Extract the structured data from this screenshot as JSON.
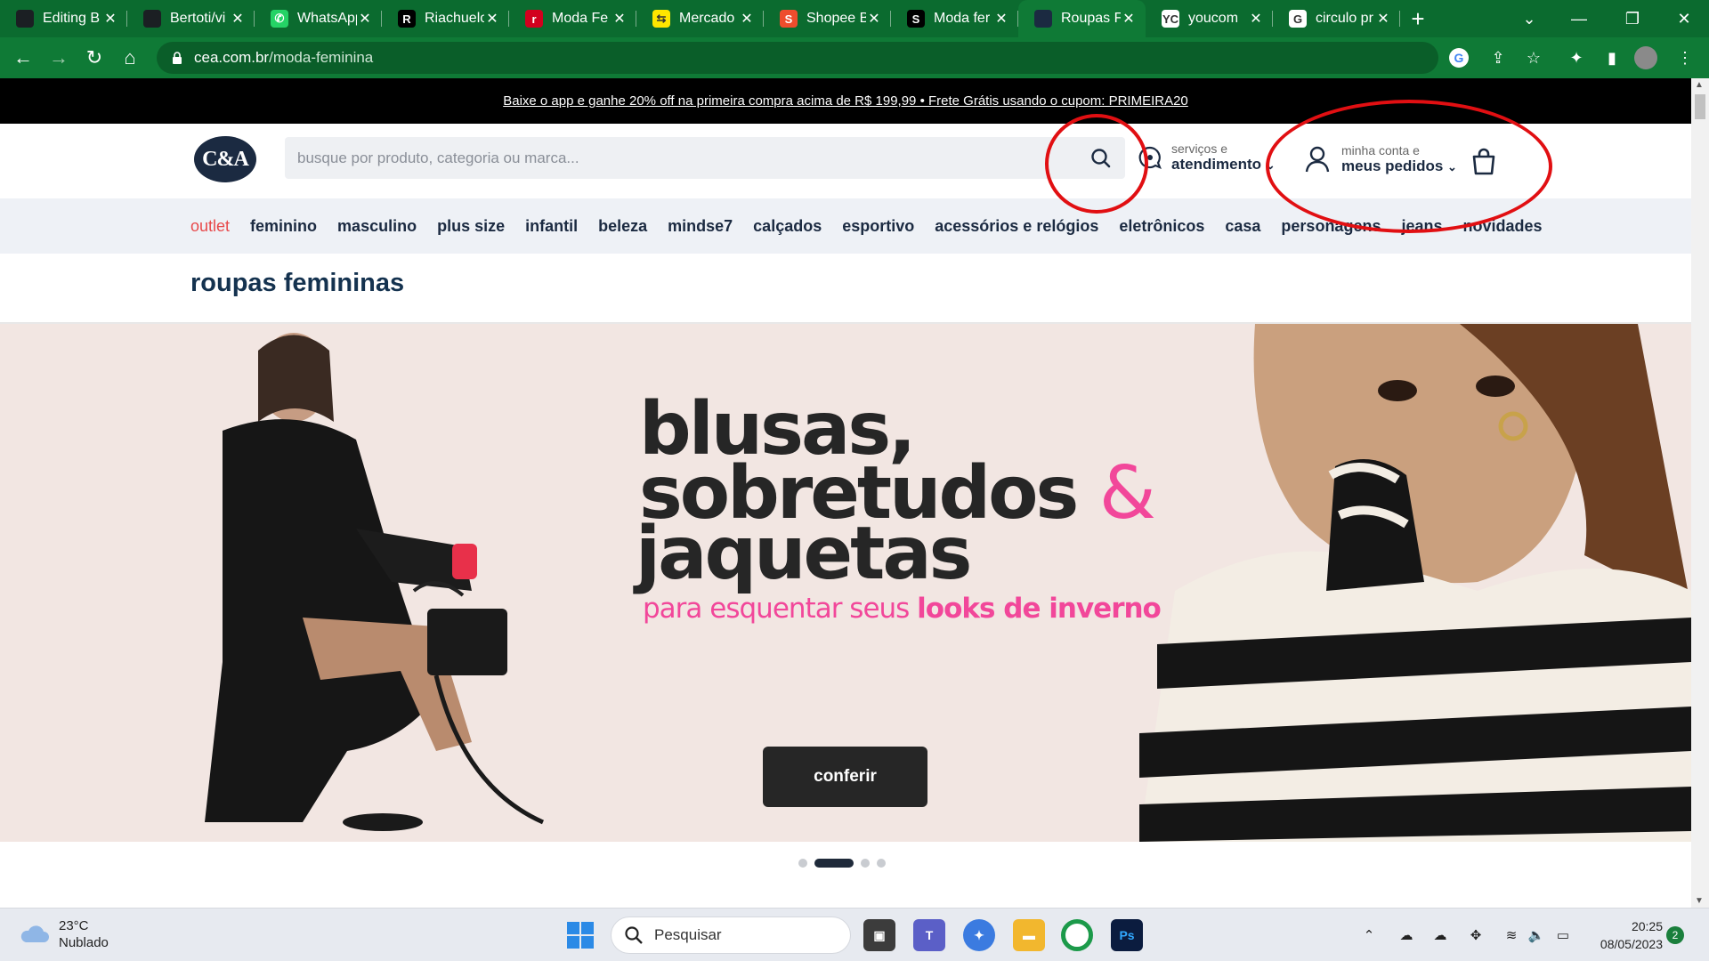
{
  "browser": {
    "tabs": [
      {
        "label": "Editing B",
        "fav": "github-icon",
        "fav_bg": "#1b1f23",
        "fav_text": "",
        "active": false
      },
      {
        "label": "Bertoti/vi",
        "fav": "github-icon",
        "fav_bg": "#1b1f23",
        "fav_text": "",
        "active": false
      },
      {
        "label": "WhatsApp",
        "fav": "whatsapp-icon",
        "fav_bg": "#25d366",
        "fav_text": "✆",
        "active": false
      },
      {
        "label": "Riachuelo",
        "fav": "riachuelo-icon",
        "fav_bg": "#000000",
        "fav_text": "R",
        "active": false
      },
      {
        "label": "Moda Fe",
        "fav": "renner-icon",
        "fav_bg": "#d2001e",
        "fav_text": "r",
        "active": false
      },
      {
        "label": "Mercado",
        "fav": "mercadolivre-icon",
        "fav_bg": "#ffe600",
        "fav_text": "⇆",
        "active": false
      },
      {
        "label": "Shopee B",
        "fav": "shopee-icon",
        "fav_bg": "#ee4d2d",
        "fav_text": "S",
        "active": false
      },
      {
        "label": "Moda fer",
        "fav": "shein-icon",
        "fav_bg": "#000000",
        "fav_text": "S",
        "active": false
      },
      {
        "label": "Roupas F",
        "fav": "cea-icon",
        "fav_bg": "#1b2a41",
        "fav_text": "",
        "active": true
      },
      {
        "label": "youcom",
        "fav": "youcom-icon",
        "fav_bg": "#ffffff",
        "fav_text": "YC",
        "active": false
      },
      {
        "label": "circulo pr",
        "fav": "google-icon",
        "fav_bg": "#ffffff",
        "fav_text": "G",
        "active": false
      }
    ],
    "new_tab": "+",
    "url_host": "cea.com.br",
    "url_path": "/moda-feminina"
  },
  "promo": {
    "text": "Baixe o app e ganhe 20% off na primeira compra acima de R$ 199,99 • Frete Grátis usando o cupom: PRIMEIRA20"
  },
  "header": {
    "logo": "C&A",
    "search_placeholder": "busque por produto, categoria ou marca...",
    "services_small": "serviços e",
    "services_big": "atendimento",
    "account_small": "minha conta e",
    "account_big": "meus pedidos"
  },
  "nav": [
    "outlet",
    "feminino",
    "masculino",
    "plus size",
    "infantil",
    "beleza",
    "mindse7",
    "calçados",
    "esportivo",
    "acessórios e relógios",
    "eletrônicos",
    "casa",
    "personagens",
    "jeans",
    "novidades"
  ],
  "page": {
    "title": "roupas femininas"
  },
  "hero": {
    "line1": "blusas,",
    "line2": "sobretudos",
    "amp": "&",
    "line3": "jaquetas",
    "sub_plain": "para esquentar seus ",
    "sub_bold": "looks de inverno",
    "cta": "conferir",
    "slides": 4,
    "active_slide": 2
  },
  "taskbar": {
    "temp": "23°C",
    "condition": "Nublado",
    "search": "Pesquisar",
    "time": "20:25",
    "date": "08/05/2023",
    "notifications": "2"
  },
  "colors": {
    "chrome_green": "#0f7a36",
    "brand_navy": "#1b2a41",
    "accent_pink": "#f2479a",
    "outlet_red": "#e8484a",
    "annotation_red": "#e10f12"
  }
}
